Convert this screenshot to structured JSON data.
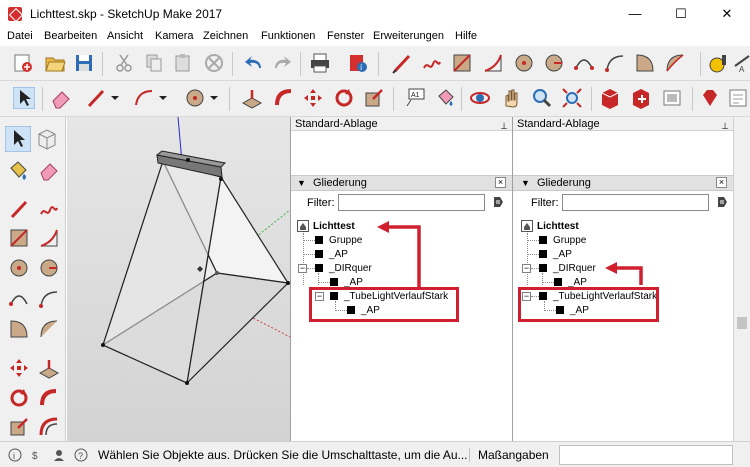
{
  "window": {
    "title": "Lichttest.skp - SketchUp Make 2017",
    "minimize_glyph": "—",
    "maximize_glyph": "☐",
    "close_glyph": "✕"
  },
  "menu": [
    "Datei",
    "Bearbeiten",
    "Ansicht",
    "Kamera",
    "Zeichnen",
    "Funktionen",
    "Fenster",
    "Erweiterungen",
    "Hilfe"
  ],
  "colors": {
    "accent_red": "#d0202f",
    "toolbar_bg": "#f0f0f0",
    "tray_bg": "#ffffff"
  },
  "trays": [
    {
      "title": "Standard-Ablage",
      "section": "Gliederung",
      "filter_label": "Filter:",
      "root": "Lichttest",
      "items": [
        "Gruppe",
        "_AP",
        "_DIRquer",
        "_AP",
        "_TubeLightVerlaufStark",
        "_AP"
      ]
    },
    {
      "title": "Standard-Ablage",
      "section": "Gliederung",
      "filter_label": "Filter:",
      "root": "Lichttest",
      "items": [
        "Gruppe",
        "_AP",
        "_DIRquer",
        "_AP",
        "_TubeLightVerlaufStark",
        "_AP"
      ]
    }
  ],
  "status": {
    "text": "Wählen Sie Objekte aus. Drücken Sie die Umschalttaste, um die Au...",
    "measure_label": "Maßangaben"
  }
}
